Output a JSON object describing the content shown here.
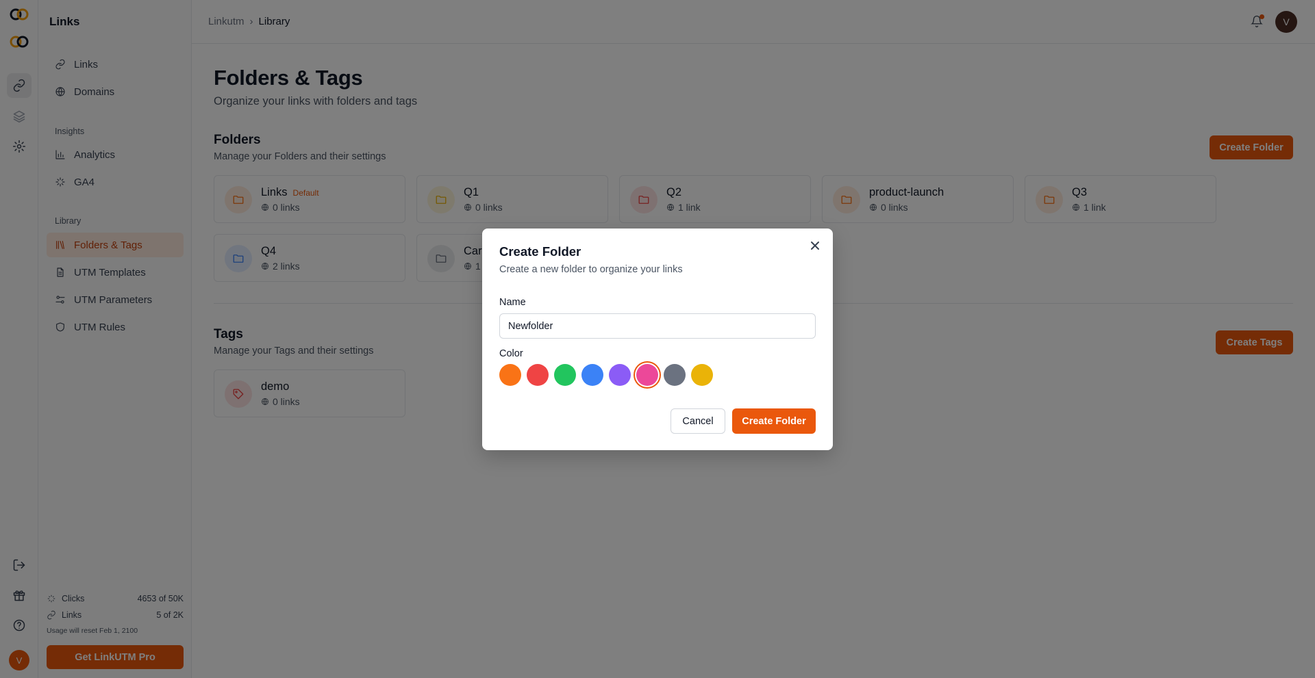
{
  "app": {
    "sidebar_title": "Links",
    "accent_color": "#ea580c"
  },
  "breadcrumb": {
    "root": "Linkutm",
    "current": "Library"
  },
  "user": {
    "initial": "V"
  },
  "sidebar": {
    "items_top": [
      {
        "label": "Links",
        "icon": "link-icon"
      },
      {
        "label": "Domains",
        "icon": "globe-icon"
      }
    ],
    "insights_label": "Insights",
    "insights": [
      {
        "label": "Analytics",
        "icon": "bar-chart-icon"
      },
      {
        "label": "GA4",
        "icon": "sparkle-icon"
      }
    ],
    "library_label": "Library",
    "library": [
      {
        "label": "Folders & Tags",
        "icon": "library-icon",
        "active": true
      },
      {
        "label": "UTM Templates",
        "icon": "document-icon"
      },
      {
        "label": "UTM Parameters",
        "icon": "sliders-icon"
      },
      {
        "label": "UTM Rules",
        "icon": "shield-icon"
      }
    ],
    "usage": {
      "clicks_label": "Clicks",
      "clicks_value": "4653 of 50K",
      "links_label": "Links",
      "links_value": "5 of 2K",
      "reset_note": "Usage will reset Feb 1, 2100"
    },
    "pro_button": "Get LinkUTM Pro"
  },
  "page": {
    "title": "Folders & Tags",
    "subtitle": "Organize your links with folders and tags"
  },
  "folders": {
    "title": "Folders",
    "subtitle": "Manage your Folders and their settings",
    "create_button": "Create Folder",
    "items": [
      {
        "name": "Links",
        "badge": "Default",
        "count": "0 links",
        "color": "#f97316"
      },
      {
        "name": "Q1",
        "badge": "",
        "count": "0 links",
        "color": "#eab308"
      },
      {
        "name": "Q2",
        "badge": "",
        "count": "1 link",
        "color": "#ef4444"
      },
      {
        "name": "product-launch",
        "badge": "",
        "count": "0 links",
        "color": "#f97316"
      },
      {
        "name": "Q3",
        "badge": "",
        "count": "1 link",
        "color": "#f97316"
      },
      {
        "name": "Q4",
        "badge": "",
        "count": "2 links",
        "color": "#3b82f6"
      },
      {
        "name": "Car",
        "badge": "",
        "count": "1",
        "color": "#6b7280"
      }
    ]
  },
  "tags": {
    "title": "Tags",
    "subtitle": "Manage your Tags and their settings",
    "create_button": "Create Tags",
    "items": [
      {
        "name": "demo",
        "count": "0 links",
        "color": "#ef4444"
      }
    ]
  },
  "modal": {
    "title": "Create Folder",
    "description": "Create a new folder to organize your links",
    "name_label": "Name",
    "name_value": "Newfolder",
    "color_label": "Color",
    "colors": [
      "#f97316",
      "#ef4444",
      "#22c55e",
      "#3b82f6",
      "#8b5cf6",
      "#ec4899",
      "#6b7280",
      "#eab308"
    ],
    "selected_color": "#ec4899",
    "cancel_button": "Cancel",
    "create_button": "Create Folder"
  }
}
